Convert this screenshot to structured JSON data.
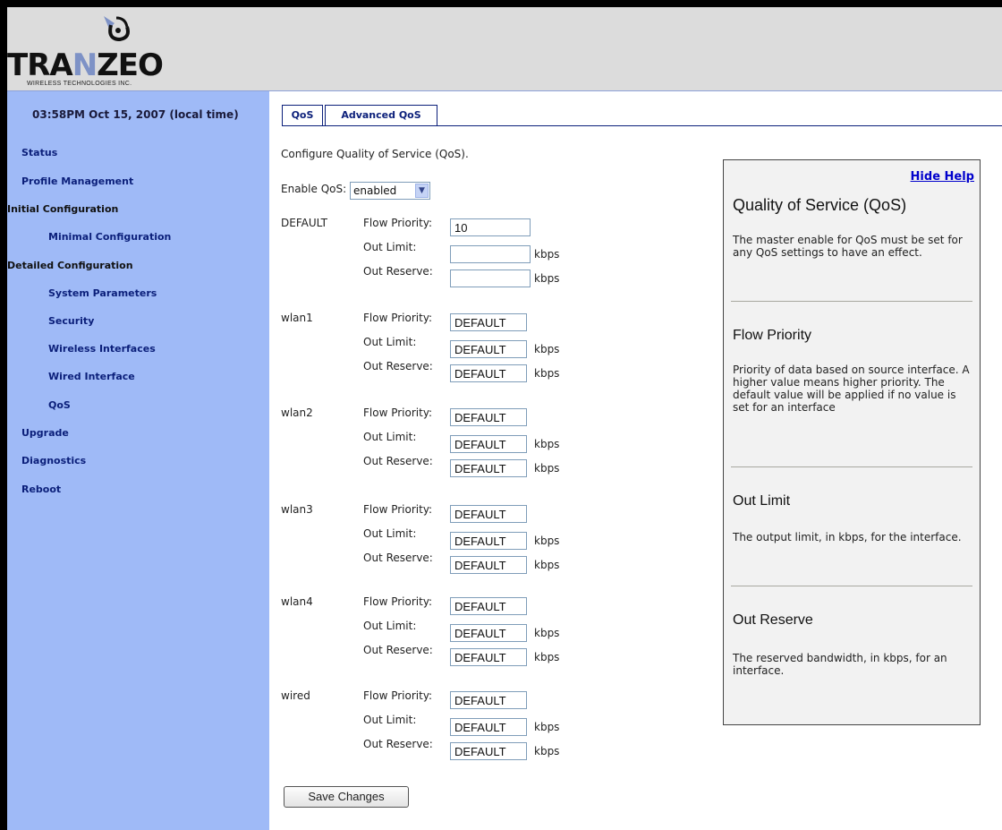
{
  "logo": {
    "wordmark_a": "TRA",
    "wordmark_n": "N",
    "wordmark_b": "ZEO",
    "subtitle": "WIRELESS TECHNOLOGIES INC."
  },
  "clock": "03:58PM Oct 15, 2007 (local time)",
  "nav": [
    {
      "label": "Status"
    },
    {
      "label": "Profile Management"
    },
    {
      "label": "Initial Configuration"
    },
    {
      "label": "Minimal Configuration"
    },
    {
      "label": "Detailed Configuration"
    },
    {
      "label": "System Parameters"
    },
    {
      "label": "Security"
    },
    {
      "label": "Wireless Interfaces"
    },
    {
      "label": "Wired Interface"
    },
    {
      "label": "QoS"
    },
    {
      "label": "Upgrade"
    },
    {
      "label": "Diagnostics"
    },
    {
      "label": "Reboot"
    }
  ],
  "tabs": [
    {
      "label": "QoS"
    },
    {
      "label": "Advanced QoS"
    }
  ],
  "intro": "Configure Quality of Service (QoS).",
  "enable": {
    "label": "Enable QoS:",
    "value": "enabled"
  },
  "field_labels": {
    "flow_priority": "Flow Priority:",
    "out_limit": "Out Limit:",
    "out_reserve": "Out Reserve:",
    "unit": "kbps"
  },
  "interfaces": [
    {
      "name": "DEFAULT",
      "flow_priority": "10",
      "out_limit": "",
      "out_reserve": ""
    },
    {
      "name": "wlan1",
      "flow_priority": "DEFAULT",
      "out_limit": "DEFAULT",
      "out_reserve": "DEFAULT"
    },
    {
      "name": "wlan2",
      "flow_priority": "DEFAULT",
      "out_limit": "DEFAULT",
      "out_reserve": "DEFAULT"
    },
    {
      "name": "wlan3",
      "flow_priority": "DEFAULT",
      "out_limit": "DEFAULT",
      "out_reserve": "DEFAULT"
    },
    {
      "name": "wlan4",
      "flow_priority": "DEFAULT",
      "out_limit": "DEFAULT",
      "out_reserve": "DEFAULT"
    },
    {
      "name": "wired",
      "flow_priority": "DEFAULT",
      "out_limit": "DEFAULT",
      "out_reserve": "DEFAULT"
    }
  ],
  "save_label": "Save Changes",
  "help": {
    "hide_label": "Hide Help",
    "sections": [
      {
        "title": "Quality of Service (QoS)",
        "text": "The master enable for QoS must be set for any QoS settings to have an effect."
      },
      {
        "title": "Flow Priority",
        "text": "Priority of data based on source interface. A higher value means higher priority. The default value will be applied if no value is set for an interface"
      },
      {
        "title": "Out Limit",
        "text": "The output limit, in kbps, for the interface."
      },
      {
        "title": "Out Reserve",
        "text": "The reserved bandwidth, in kbps, for an interface."
      }
    ]
  },
  "colors": {
    "sidebar_bg": "#9fbaf7",
    "nav_link": "#0b1f7a",
    "header_bg": "#dcdcdc",
    "help_bg": "#f2f2f2",
    "link": "#0000cc"
  }
}
